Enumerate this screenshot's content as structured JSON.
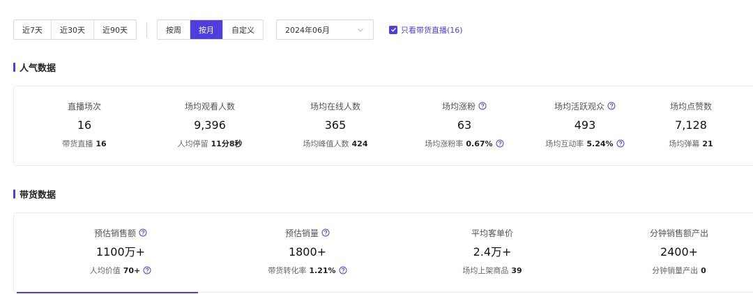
{
  "filters": {
    "ranges": [
      "近7天",
      "近30天",
      "近90天"
    ],
    "periods": [
      "按周",
      "按月",
      "自定义"
    ],
    "active_period": 1,
    "month_select": "2024年06月",
    "checkbox_label": "只看带货直播(16)"
  },
  "popularity": {
    "title": "人气数据",
    "metrics": [
      {
        "label": "直播场次",
        "value": "16",
        "sub_label": "带货直播",
        "sub_value": "16"
      },
      {
        "label": "场均观看人数",
        "value": "9,396",
        "sub_label": "人均停留",
        "sub_value": "11分8秒"
      },
      {
        "label": "场均在线人数",
        "value": "365",
        "sub_label": "场均峰值人数",
        "sub_value": "424"
      },
      {
        "label": "场均涨粉",
        "value": "63",
        "sub_label": "场均涨粉率",
        "sub_value": "0.67%"
      },
      {
        "label": "场均活跃观众",
        "value": "493",
        "sub_label": "场均互动率",
        "sub_value": "5.24%"
      },
      {
        "label": "场均点赞数",
        "value": "7,128",
        "sub_label": "场均弹幕",
        "sub_value": "21"
      }
    ]
  },
  "sales": {
    "title": "带货数据",
    "metrics": [
      {
        "label": "预估销售额",
        "value": "1100万+",
        "sub_label": "人均价值",
        "sub_value": "70+"
      },
      {
        "label": "预估销量",
        "value": "1800+",
        "sub_label": "带货转化率",
        "sub_value": "1.21%"
      },
      {
        "label": "平均客单价",
        "value": "2.4万+",
        "sub_label": "场均上架商品",
        "sub_value": "39"
      },
      {
        "label": "分钟销售额产出",
        "value": "2400+",
        "sub_label": "分钟销量产出",
        "sub_value": "0"
      }
    ]
  },
  "colors": {
    "accent": "#4e3ee0"
  }
}
